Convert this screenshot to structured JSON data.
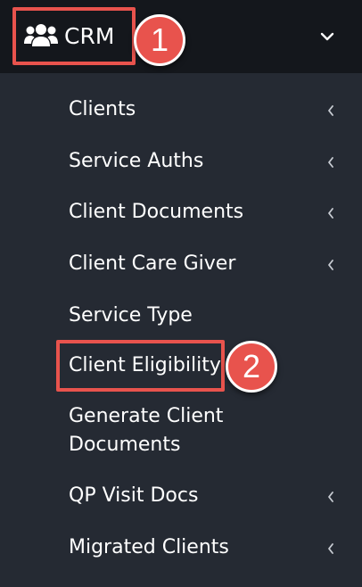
{
  "header": {
    "title": "CRM",
    "icon": "users-group-icon",
    "expand_icon": "chevron-down-icon"
  },
  "menu": {
    "items": [
      {
        "label": "Clients",
        "has_submenu": true
      },
      {
        "label": "Service Auths",
        "has_submenu": true
      },
      {
        "label": "Client Documents",
        "has_submenu": true
      },
      {
        "label": "Client Care Giver",
        "has_submenu": true
      },
      {
        "label": "Service Type",
        "has_submenu": false
      },
      {
        "label": "Client Eligibility",
        "has_submenu": false
      },
      {
        "label_line1": "Generate Client",
        "label_line2": "Documents",
        "has_submenu": false
      },
      {
        "label": "QP Visit Docs",
        "has_submenu": true
      },
      {
        "label": "Migrated Clients",
        "has_submenu": true
      }
    ]
  },
  "annotations": {
    "callout_1": "1",
    "callout_2": "2"
  },
  "colors": {
    "header_bg": "#14171c",
    "menu_bg": "#252a33",
    "callout": "#e8534d",
    "text": "#ffffff"
  }
}
